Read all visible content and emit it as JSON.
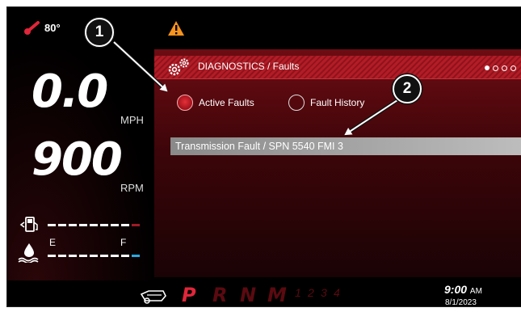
{
  "status": {
    "temperature": "80°",
    "thermometer_icon": "thermometer-icon",
    "warning_icon": "warning-icon"
  },
  "speed": {
    "value": "0.0",
    "unit": "MPH"
  },
  "rpm": {
    "value": "900",
    "unit": "RPM"
  },
  "fuel": {
    "icon": "fuel-pump-icon",
    "level_fraction": 1.0
  },
  "coolant": {
    "icon": "coolant-temp-icon",
    "empty_label": "E",
    "full_label": "F",
    "level_fraction": 1.0
  },
  "diagnostics": {
    "icon": "gears-icon",
    "title": "DIAGNOSTICS / Faults",
    "page_indicator": {
      "total": 4,
      "current": 1
    },
    "active_faults_label": "Active Faults",
    "fault_history_label": "Fault History",
    "selected": "Active Faults",
    "faults": [
      "Transmission Fault / SPN 5540 FMI 3"
    ]
  },
  "gears": {
    "icon": "transmission-icon",
    "main": [
      "P",
      "R",
      "N",
      "M"
    ],
    "selected": "P",
    "manual": [
      "1",
      "2",
      "3",
      "4"
    ]
  },
  "clock": {
    "time": "9:00",
    "ampm": "AM",
    "date": "8/1/2023"
  },
  "callouts": [
    "1",
    "2"
  ],
  "colors": {
    "accent_red": "#e0263a",
    "panel_red": "#6d0c13",
    "coolant_blue": "#29a9e0",
    "warning_orange": "#f7931e"
  }
}
